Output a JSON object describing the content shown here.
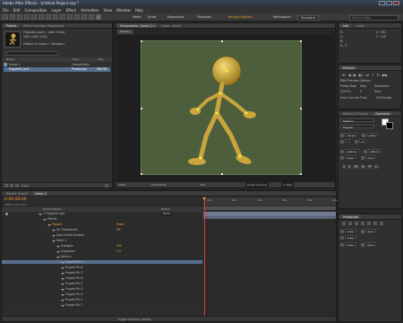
{
  "app": {
    "title": "Adobe After Effects - Untitled Project.aep *",
    "window_controls": [
      "minimize",
      "maximize",
      "close"
    ]
  },
  "menu": [
    "File",
    "Edit",
    "Composition",
    "Layer",
    "Effect",
    "Animation",
    "View",
    "Window",
    "Help"
  ],
  "toolbar": {
    "snapping_label": "Mesh:",
    "show_label": "Show",
    "expansion_label": "Expansion:",
    "triangles_label": "Triangles:",
    "record_label": "Record Options",
    "workspace_label": "Workspace:",
    "workspace_value": "Standard",
    "search_placeholder": "Search Help"
  },
  "project_panel": {
    "tabs": [
      "Project",
      "Effect Controls: Puppet.psd"
    ],
    "selected_name": "Puppet01.psd ▾ , used 1 time",
    "selected_dims": "200 x 400 (1.00)",
    "selected_info": "Millions of Colors+ (Straight)",
    "columns": [
      "Name",
      "Type",
      "Size"
    ],
    "items": [
      {
        "name": "Comp 1",
        "type": "Composition",
        "size": ""
      },
      {
        "name": "Puppet01.psd",
        "type": "Photoshop",
        "size": "289 KB"
      }
    ],
    "bit_depth": "8 bpc"
  },
  "comp_panel": {
    "tab": "Composition: Comp 1 ▾",
    "layer_tab": "Layer: (none)",
    "breadcrumb": "Comp 1",
    "zoom": "100%",
    "timecode": "0:00:00:00",
    "quality": "Full",
    "camera": "Active Camera",
    "views": "1 View"
  },
  "info_panel": {
    "tabs": [
      "Info",
      "Audio"
    ],
    "r": "R :",
    "g": "G :",
    "b": "B :",
    "a": "A : 0",
    "x": "X : 632",
    "y": "Y : 112"
  },
  "preview_panel": {
    "title": "Preview",
    "ram_label": "RAM Preview Options",
    "frame_rate_label": "Frame Rate",
    "skip_label": "Skip",
    "resolution_label": "Resolution",
    "frame_rate_value": "(29.97)",
    "skip_value": "0",
    "resolution_value": "Auto",
    "from_current": "From Current Time",
    "full_screen": "Full Screen"
  },
  "effects_panel": {
    "tabs": [
      "Effects & Presets",
      "Character"
    ],
    "font": "Palatino",
    "style": "Regular",
    "size": "72 px",
    "leading": "Auto",
    "tracking": "0",
    "scale_v": "100 %",
    "scale_h": "100 %",
    "baseline": "0 px",
    "tsume": "0 %"
  },
  "paragraph_panel": {
    "title": "Paragraph",
    "indent1": "0 px",
    "indent2": "0 px",
    "indent3": "0 px",
    "space1": "0 px",
    "space2": "0 px"
  },
  "timeline": {
    "tabs": [
      "Render Queue",
      "Comp 1"
    ],
    "timecode": "0:00:00:00",
    "fps_note": "00000 (29.97 fps)",
    "source_col": "Source Name",
    "parent_col": "Parent",
    "ruler": [
      "00s",
      "02s",
      "04s",
      "06s",
      "08s",
      "10s"
    ],
    "rows": [
      {
        "indent": 0,
        "label": "1  Puppet01.psd",
        "value": "",
        "orange": false,
        "selected": false
      },
      {
        "indent": 1,
        "label": "Effects",
        "value": "",
        "orange": false,
        "selected": false
      },
      {
        "indent": 2,
        "label": "Puppet",
        "value": "Reset",
        "orange": true,
        "selected": false
      },
      {
        "indent": 3,
        "label": "On Transparent",
        "value": "Off",
        "orange": false,
        "selected": false
      },
      {
        "indent": 3,
        "label": "Auto-traced Shapes",
        "value": "",
        "orange": false,
        "selected": false
      },
      {
        "indent": 3,
        "label": "Mesh 1",
        "value": "",
        "orange": false,
        "selected": false
      },
      {
        "indent": 4,
        "label": "Triangles",
        "value": "350",
        "orange": false,
        "selected": false
      },
      {
        "indent": 4,
        "label": "Expansion",
        "value": "3.0",
        "orange": false,
        "selected": false
      },
      {
        "indent": 4,
        "label": "Deform",
        "value": "",
        "orange": false,
        "selected": false
      },
      {
        "indent": 5,
        "label": "Puppet Pin 9",
        "value": "",
        "orange": false,
        "selected": true
      },
      {
        "indent": 5,
        "label": "Puppet Pin 8",
        "value": "",
        "orange": false,
        "selected": false
      },
      {
        "indent": 5,
        "label": "Puppet Pin 7",
        "value": "",
        "orange": false,
        "selected": false
      },
      {
        "indent": 5,
        "label": "Puppet Pin 6",
        "value": "",
        "orange": false,
        "selected": false
      },
      {
        "indent": 5,
        "label": "Puppet Pin 5",
        "value": "",
        "orange": false,
        "selected": false
      },
      {
        "indent": 5,
        "label": "Puppet Pin 4",
        "value": "",
        "orange": false,
        "selected": false
      },
      {
        "indent": 5,
        "label": "Puppet Pin 3",
        "value": "",
        "orange": false,
        "selected": false
      },
      {
        "indent": 5,
        "label": "Puppet Pin 2",
        "value": "",
        "orange": false,
        "selected": false
      },
      {
        "indent": 5,
        "label": "Puppet Pin 1",
        "value": "",
        "orange": false,
        "selected": false
      }
    ],
    "parent_value": "None",
    "footer": "Toggle Switches / Modes"
  },
  "colors": {
    "accent": "#f39c2c",
    "selection": "#58708f",
    "canvas": "#4d5e3c",
    "puppet": "#d9b84a"
  }
}
